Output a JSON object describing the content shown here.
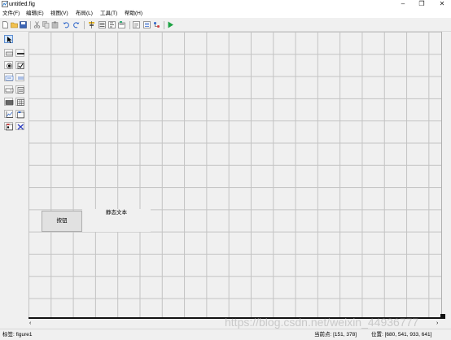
{
  "window": {
    "title": "untitled.fig",
    "controls": {
      "minimize": "–",
      "restore": "❐",
      "close": "✕"
    }
  },
  "menu": {
    "items": [
      "文件(F)",
      "编辑(E)",
      "视图(V)",
      "布局(L)",
      "工具(T)",
      "帮助(H)"
    ]
  },
  "toolbar": {
    "icons": [
      "new-icon",
      "open-icon",
      "save-icon",
      "cut-icon",
      "copy-icon",
      "paste-icon",
      "undo-icon",
      "redo-icon",
      "align-icon",
      "menu-editor-icon",
      "tab-order-icon",
      "toolbar-editor-icon",
      "editor-icon",
      "property-inspector-icon",
      "object-browser-icon",
      "run-icon"
    ]
  },
  "palette": {
    "tools": [
      "select-tool",
      "push-button-tool",
      "slider-tool",
      "radio-button-tool",
      "checkbox-tool",
      "edit-text-tool",
      "static-text-tool",
      "popup-menu-tool",
      "listbox-tool",
      "toggle-button-tool",
      "table-tool",
      "axes-tool",
      "panel-tool",
      "button-group-tool",
      "activex-tool"
    ]
  },
  "canvas": {
    "push_button_label": "按钮",
    "static_text_label": "静态文本"
  },
  "scrollbar": {
    "left_arrow": "‹",
    "right_arrow": "›"
  },
  "status": {
    "tag": "标签: figure1",
    "current_point": "当前点:  [151, 378]",
    "position": "位置:  [680, 541, 933, 641]"
  },
  "watermark": "https://blog.csdn.net/weixin_44936777"
}
